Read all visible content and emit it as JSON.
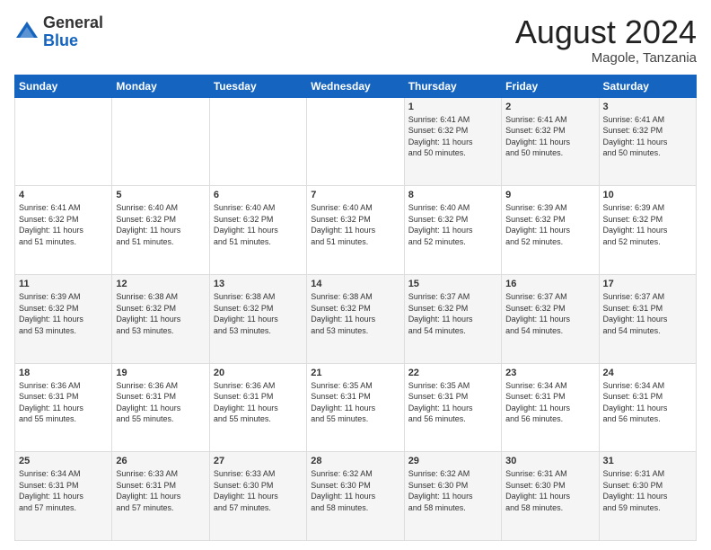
{
  "header": {
    "logo": {
      "general": "General",
      "blue": "Blue"
    },
    "month_year": "August 2024",
    "location": "Magole, Tanzania"
  },
  "days_of_week": [
    "Sunday",
    "Monday",
    "Tuesday",
    "Wednesday",
    "Thursday",
    "Friday",
    "Saturday"
  ],
  "weeks": [
    [
      {
        "day": "",
        "info": ""
      },
      {
        "day": "",
        "info": ""
      },
      {
        "day": "",
        "info": ""
      },
      {
        "day": "",
        "info": ""
      },
      {
        "day": "1",
        "info": "Sunrise: 6:41 AM\nSunset: 6:32 PM\nDaylight: 11 hours\nand 50 minutes."
      },
      {
        "day": "2",
        "info": "Sunrise: 6:41 AM\nSunset: 6:32 PM\nDaylight: 11 hours\nand 50 minutes."
      },
      {
        "day": "3",
        "info": "Sunrise: 6:41 AM\nSunset: 6:32 PM\nDaylight: 11 hours\nand 50 minutes."
      }
    ],
    [
      {
        "day": "4",
        "info": "Sunrise: 6:41 AM\nSunset: 6:32 PM\nDaylight: 11 hours\nand 51 minutes."
      },
      {
        "day": "5",
        "info": "Sunrise: 6:40 AM\nSunset: 6:32 PM\nDaylight: 11 hours\nand 51 minutes."
      },
      {
        "day": "6",
        "info": "Sunrise: 6:40 AM\nSunset: 6:32 PM\nDaylight: 11 hours\nand 51 minutes."
      },
      {
        "day": "7",
        "info": "Sunrise: 6:40 AM\nSunset: 6:32 PM\nDaylight: 11 hours\nand 51 minutes."
      },
      {
        "day": "8",
        "info": "Sunrise: 6:40 AM\nSunset: 6:32 PM\nDaylight: 11 hours\nand 52 minutes."
      },
      {
        "day": "9",
        "info": "Sunrise: 6:39 AM\nSunset: 6:32 PM\nDaylight: 11 hours\nand 52 minutes."
      },
      {
        "day": "10",
        "info": "Sunrise: 6:39 AM\nSunset: 6:32 PM\nDaylight: 11 hours\nand 52 minutes."
      }
    ],
    [
      {
        "day": "11",
        "info": "Sunrise: 6:39 AM\nSunset: 6:32 PM\nDaylight: 11 hours\nand 53 minutes."
      },
      {
        "day": "12",
        "info": "Sunrise: 6:38 AM\nSunset: 6:32 PM\nDaylight: 11 hours\nand 53 minutes."
      },
      {
        "day": "13",
        "info": "Sunrise: 6:38 AM\nSunset: 6:32 PM\nDaylight: 11 hours\nand 53 minutes."
      },
      {
        "day": "14",
        "info": "Sunrise: 6:38 AM\nSunset: 6:32 PM\nDaylight: 11 hours\nand 53 minutes."
      },
      {
        "day": "15",
        "info": "Sunrise: 6:37 AM\nSunset: 6:32 PM\nDaylight: 11 hours\nand 54 minutes."
      },
      {
        "day": "16",
        "info": "Sunrise: 6:37 AM\nSunset: 6:32 PM\nDaylight: 11 hours\nand 54 minutes."
      },
      {
        "day": "17",
        "info": "Sunrise: 6:37 AM\nSunset: 6:31 PM\nDaylight: 11 hours\nand 54 minutes."
      }
    ],
    [
      {
        "day": "18",
        "info": "Sunrise: 6:36 AM\nSunset: 6:31 PM\nDaylight: 11 hours\nand 55 minutes."
      },
      {
        "day": "19",
        "info": "Sunrise: 6:36 AM\nSunset: 6:31 PM\nDaylight: 11 hours\nand 55 minutes."
      },
      {
        "day": "20",
        "info": "Sunrise: 6:36 AM\nSunset: 6:31 PM\nDaylight: 11 hours\nand 55 minutes."
      },
      {
        "day": "21",
        "info": "Sunrise: 6:35 AM\nSunset: 6:31 PM\nDaylight: 11 hours\nand 55 minutes."
      },
      {
        "day": "22",
        "info": "Sunrise: 6:35 AM\nSunset: 6:31 PM\nDaylight: 11 hours\nand 56 minutes."
      },
      {
        "day": "23",
        "info": "Sunrise: 6:34 AM\nSunset: 6:31 PM\nDaylight: 11 hours\nand 56 minutes."
      },
      {
        "day": "24",
        "info": "Sunrise: 6:34 AM\nSunset: 6:31 PM\nDaylight: 11 hours\nand 56 minutes."
      }
    ],
    [
      {
        "day": "25",
        "info": "Sunrise: 6:34 AM\nSunset: 6:31 PM\nDaylight: 11 hours\nand 57 minutes."
      },
      {
        "day": "26",
        "info": "Sunrise: 6:33 AM\nSunset: 6:31 PM\nDaylight: 11 hours\nand 57 minutes."
      },
      {
        "day": "27",
        "info": "Sunrise: 6:33 AM\nSunset: 6:30 PM\nDaylight: 11 hours\nand 57 minutes."
      },
      {
        "day": "28",
        "info": "Sunrise: 6:32 AM\nSunset: 6:30 PM\nDaylight: 11 hours\nand 58 minutes."
      },
      {
        "day": "29",
        "info": "Sunrise: 6:32 AM\nSunset: 6:30 PM\nDaylight: 11 hours\nand 58 minutes."
      },
      {
        "day": "30",
        "info": "Sunrise: 6:31 AM\nSunset: 6:30 PM\nDaylight: 11 hours\nand 58 minutes."
      },
      {
        "day": "31",
        "info": "Sunrise: 6:31 AM\nSunset: 6:30 PM\nDaylight: 11 hours\nand 59 minutes."
      }
    ]
  ]
}
